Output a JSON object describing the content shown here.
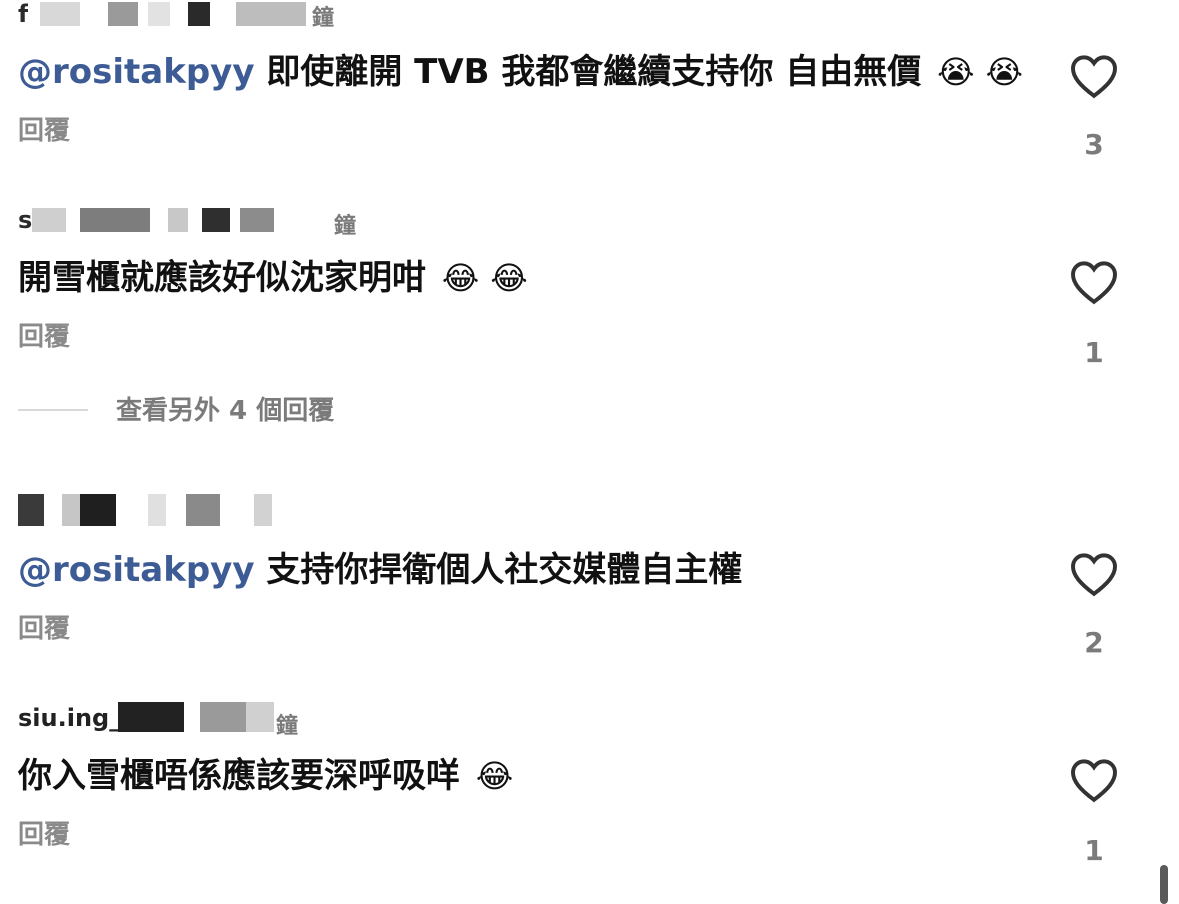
{
  "comments": [
    {
      "username_visible": "f",
      "meta_visible": "鐘",
      "mention": "@rositakpyy",
      "text": " 即使離開 TVB 我都會繼續支持你 自由無價",
      "emoji": "😭 😭",
      "reply_label": "回覆",
      "likes": "3"
    },
    {
      "username_visible": "s",
      "meta_visible": "鐘",
      "mention": "",
      "text": "開雪櫃就應該好似沈家明咁",
      "emoji": "😂 😂",
      "reply_label": "回覆",
      "likes": "1"
    },
    {
      "username_visible": "",
      "meta_visible": "",
      "mention": "@rositakpyy",
      "text": " 支持你捍衛個人社交媒體自主權",
      "emoji": "",
      "reply_label": "回覆",
      "likes": "2"
    },
    {
      "username_visible": "siu.ing_",
      "meta_visible": "鐘",
      "mention": "",
      "text": "你入雪櫃唔係應該要深呼吸咩",
      "emoji": "😂",
      "reply_label": "回覆",
      "likes": "1"
    }
  ],
  "view_more_replies": "查看另外 4 個回覆",
  "icons": {
    "like": "heart-outline-icon"
  },
  "colors": {
    "mention": "#3d5b94",
    "secondary_text": "#8a8a8a"
  }
}
